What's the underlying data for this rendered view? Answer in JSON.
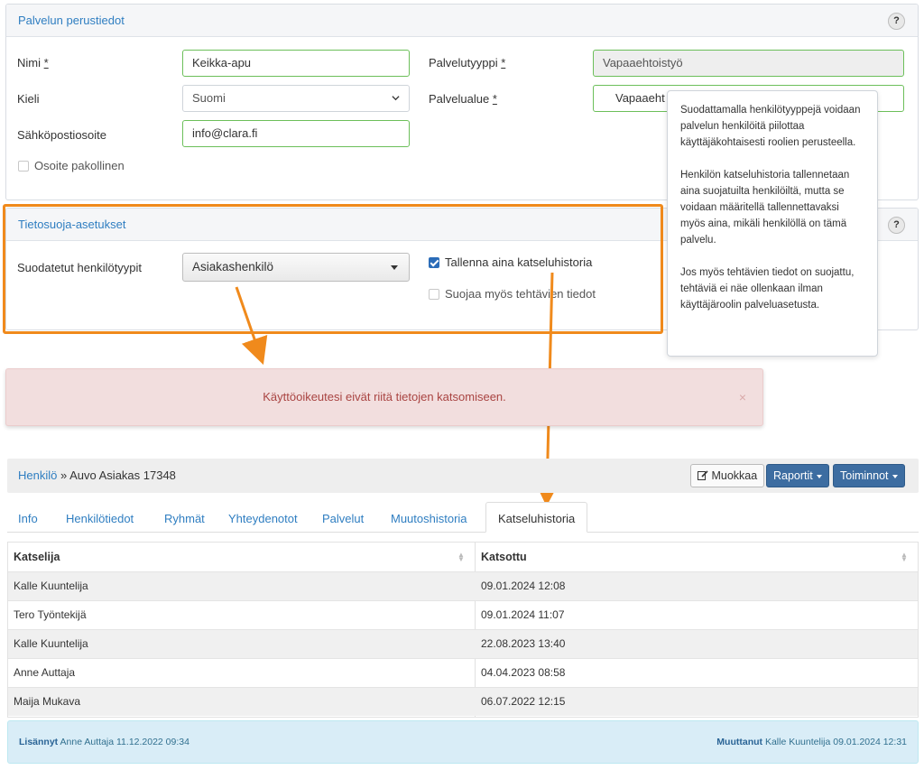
{
  "basics": {
    "title": "Palvelun perustiedot",
    "help": "?",
    "name_label": "Nimi",
    "name_value": "Keikka-apu",
    "type_label": "Palvelutyyppi",
    "type_value": "Vapaaehtoistyö",
    "lang_label": "Kieli",
    "lang_value": "Suomi",
    "area_label": "Palvelualue",
    "area_value": "Vapaaeht",
    "email_label": "Sähköpostiosoite",
    "email_value": "info@clara.fi",
    "addr_required_label": "Osoite pakollinen",
    "required_mark": "*"
  },
  "privacy": {
    "title": "Tietosuoja-asetukset",
    "help": "?",
    "filtered_label": "Suodatetut henkilötyypit",
    "filtered_value": "Asiakashenkilö",
    "save_history_label": "Tallenna aina katseluhistoria",
    "save_history_checked": true,
    "protect_tasks_label": "Suojaa myös tehtävien tiedot",
    "protect_tasks_checked": false
  },
  "tooltip": {
    "p1": "Suodattamalla henkilötyyppejä voidaan palvelun henkilöitä piilottaa käyttäjäkohtaisesti roolien perusteella.",
    "p2": "Henkilön katseluhistoria tallennetaan aina suojatuilta henkilöiltä, mutta se voidaan määritellä tallennettavaksi myös aina, mikäli henkilöllä on tämä palvelu.",
    "p3": "Jos myös tehtävien tiedot on suojattu, tehtäviä ei näe ollenkaan ilman käyttäjäroolin palveluasetusta."
  },
  "alert": {
    "message": "Käyttöoikeutesi eivät riitä tietojen katsomiseen.",
    "close": "×"
  },
  "person": {
    "crumb_link": "Henkilö",
    "crumb_sep": " » ",
    "crumb_name": "Auvo Asiakas 17348",
    "edit_label": "Muokkaa",
    "reports_label": "Raportit",
    "actions_label": "Toiminnot"
  },
  "tabs": [
    "Info",
    "Henkilötiedot",
    "Ryhmät",
    "Yhteydenotot",
    "Palvelut",
    "Muutoshistoria",
    "Katseluhistoria"
  ],
  "table": {
    "headers": [
      "Katselija",
      "Katsottu"
    ],
    "rows": [
      [
        "Kalle Kuuntelija",
        "09.01.2024 12:08"
      ],
      [
        "Tero Työntekijä",
        "09.01.2024 11:07"
      ],
      [
        "Kalle Kuuntelija",
        "22.08.2023 13:40"
      ],
      [
        "Anne Auttaja",
        "04.04.2023 08:58"
      ],
      [
        "Maija Mukava",
        "06.07.2022 12:15"
      ]
    ]
  },
  "footer": {
    "added_label": "Lisännyt",
    "added_value": "Anne Auttaja 11.12.2022 09:34",
    "modified_label": "Muuttanut",
    "modified_value": "Kalle Kuuntelija 09.01.2024 12:31"
  },
  "colors": {
    "highlight": "#f08a1c",
    "link": "#2f7ec1",
    "primary_button": "#3d6da1",
    "alert_bg": "#f2dede",
    "footer_bg": "#d9edf7"
  }
}
